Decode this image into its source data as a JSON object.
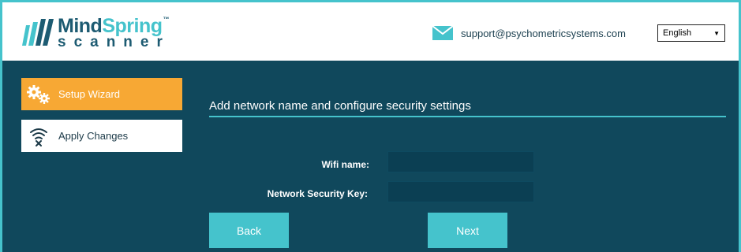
{
  "brand": {
    "name_part1": "Mind",
    "name_part2": "Spring",
    "trademark": "™",
    "subtitle": "scanner",
    "primary_color": "#1d5b72",
    "accent_color": "#45c3cc"
  },
  "header": {
    "support_icon": "mail-icon",
    "support_email": "support@psychometricsystems.com",
    "language": {
      "selected": "English",
      "options": [
        "English"
      ]
    }
  },
  "sidebar": {
    "items": [
      {
        "label": "Setup Wizard",
        "icon": "gears-icon",
        "active": true,
        "color": "#f7a834"
      },
      {
        "label": "Apply Changes",
        "icon": "wifi-off-icon",
        "active": false,
        "color": "#ffffff"
      }
    ]
  },
  "main": {
    "title": "Add network name and configure security settings",
    "fields": {
      "wifi_name": {
        "label": "Wifi name:",
        "value": ""
      },
      "security_key": {
        "label": "Network Security Key:",
        "value": ""
      }
    },
    "buttons": {
      "back": "Back",
      "next": "Next"
    },
    "background_color": "#10485c"
  }
}
